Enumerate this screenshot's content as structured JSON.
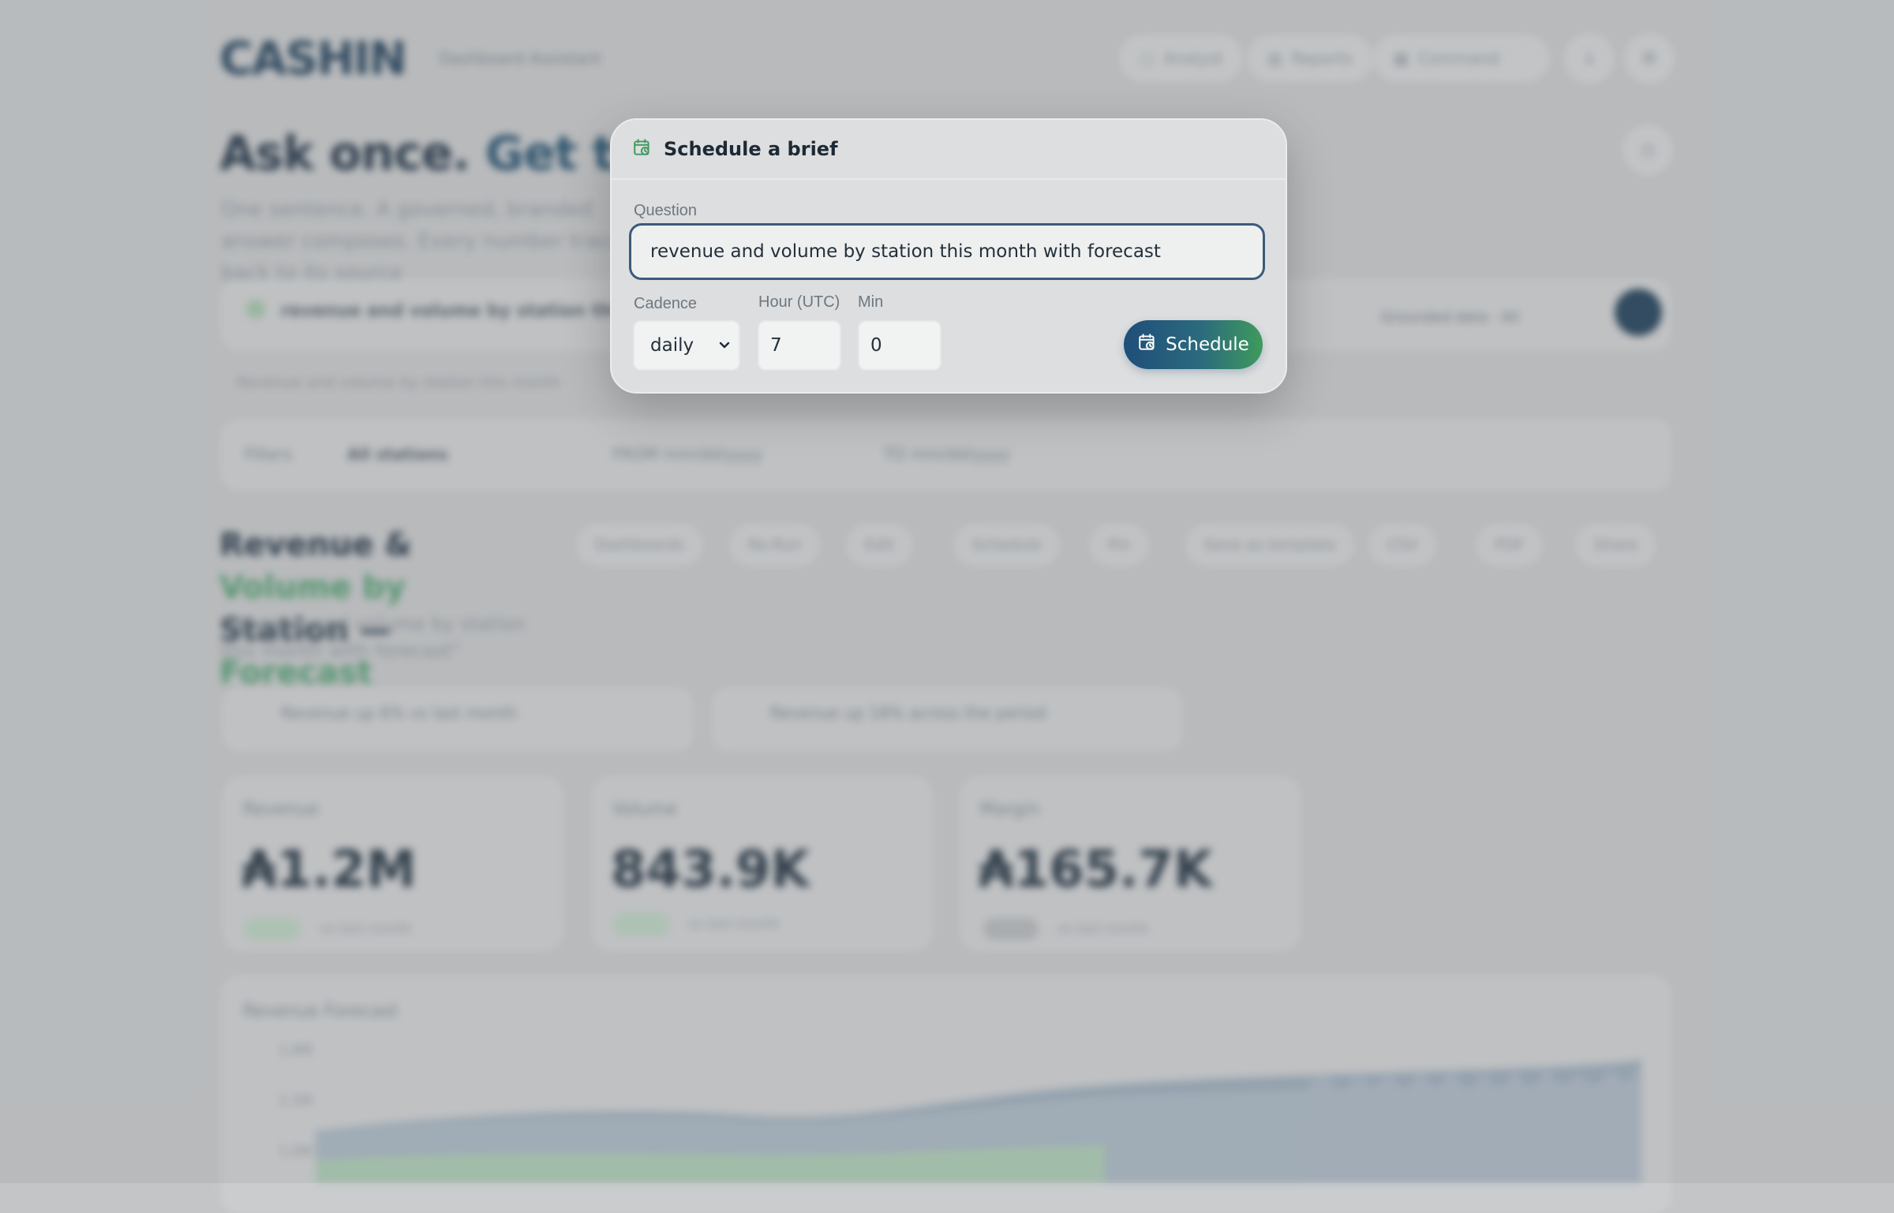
{
  "background": {
    "logo": "CASHIN",
    "tagline": "Dashboard Assistant",
    "nav": {
      "pill1": "Analyst",
      "pill2": "Reports",
      "pill3": "Command"
    },
    "hero": {
      "title_part1": "Ask once. ",
      "title_part2": "Get the w",
      "subtitle": "One sentence. A governed, branded answer composes. Every number traces back to its source"
    },
    "ask_bar": {
      "query": "revenue and volume by station this month",
      "status": "Grounded data · All"
    },
    "suggestions": "Revenue and volume by station this month",
    "filters": {
      "label": "Filters",
      "station": "All stations",
      "from": "FROM mm/dd/yyyy",
      "to": "TO mm/dd/yyyy"
    },
    "section": {
      "title_part1": "Revenue & ",
      "title_part2": "Volume by",
      "title_part3": "Station — ",
      "title_part4": "Forecast",
      "subtitle": "\"revenue and volume by station this month with forecast\""
    },
    "toolbar": [
      "Dashboards",
      "Re-Run",
      "Edit",
      "Schedule",
      "Pin",
      "Save as template",
      "CSV",
      "PDF",
      "Share"
    ],
    "insights": [
      "Revenue up 6% vs last month",
      "Revenue up 18% across the period"
    ],
    "kpis": [
      {
        "label": "Revenue",
        "value": "₳1.2M",
        "note": "vs last month"
      },
      {
        "label": "Volume",
        "value": "843.9K",
        "note": "vs last month"
      },
      {
        "label": "Margin",
        "value": "₳165.7K",
        "note": "vs last month"
      }
    ],
    "chart": {
      "title": "Revenue Forecast",
      "ticks": [
        "1.8M",
        "1.5M",
        "1.0M"
      ]
    }
  },
  "modal": {
    "title": "Schedule a brief",
    "question_label": "Question",
    "question_value": "revenue and volume by station this month with forecast",
    "cadence_label": "Cadence",
    "cadence_value": "daily",
    "hour_label": "Hour (UTC)",
    "hour_value": "7",
    "min_label": "Min",
    "min_value": "0",
    "schedule_label": "Schedule"
  },
  "colors": {
    "brand": "#27445c",
    "accent_green": "#3f9a5c",
    "focus_border": "#3c5a7a"
  }
}
